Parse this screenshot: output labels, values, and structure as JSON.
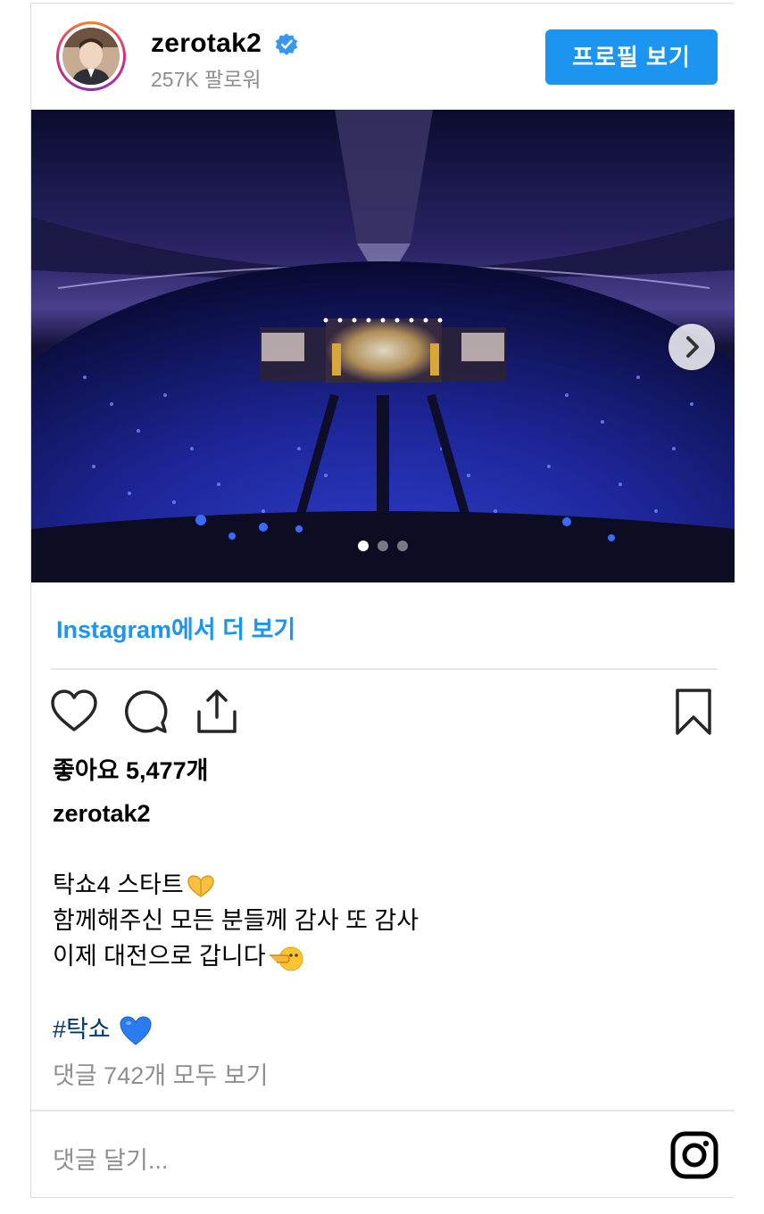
{
  "header": {
    "username": "zerotak2",
    "followers": "257K 팔로워",
    "profile_button": "프로필 보기"
  },
  "post": {
    "carousel_total": 3,
    "carousel_active": 1
  },
  "more_link": "Instagram에서 더 보기",
  "likes": "좋아요 5,477개",
  "caption": {
    "username": "zerotak2",
    "lines": [
      "탁쇼4 스타트",
      "함께해주신 모든 분들께 감사 또 감사",
      "이제 대전으로 갑니다"
    ],
    "emojis": [
      "heart-hands-emoji",
      "pointing-left-emoji"
    ],
    "hashtag": "#탁쇼",
    "hashtag_emoji": "blue-heart-emoji"
  },
  "view_comments": "댓글 742개 모두 보기",
  "comment_placeholder": "댓글 달기...",
  "icons": [
    "verified-icon",
    "heart-icon",
    "comment-icon",
    "share-icon",
    "bookmark-icon",
    "chevron-right-icon",
    "instagram-icon"
  ],
  "colors": {
    "accent": "#1b95f0",
    "hashtag": "#00376b",
    "muted": "#8e8e8e"
  }
}
